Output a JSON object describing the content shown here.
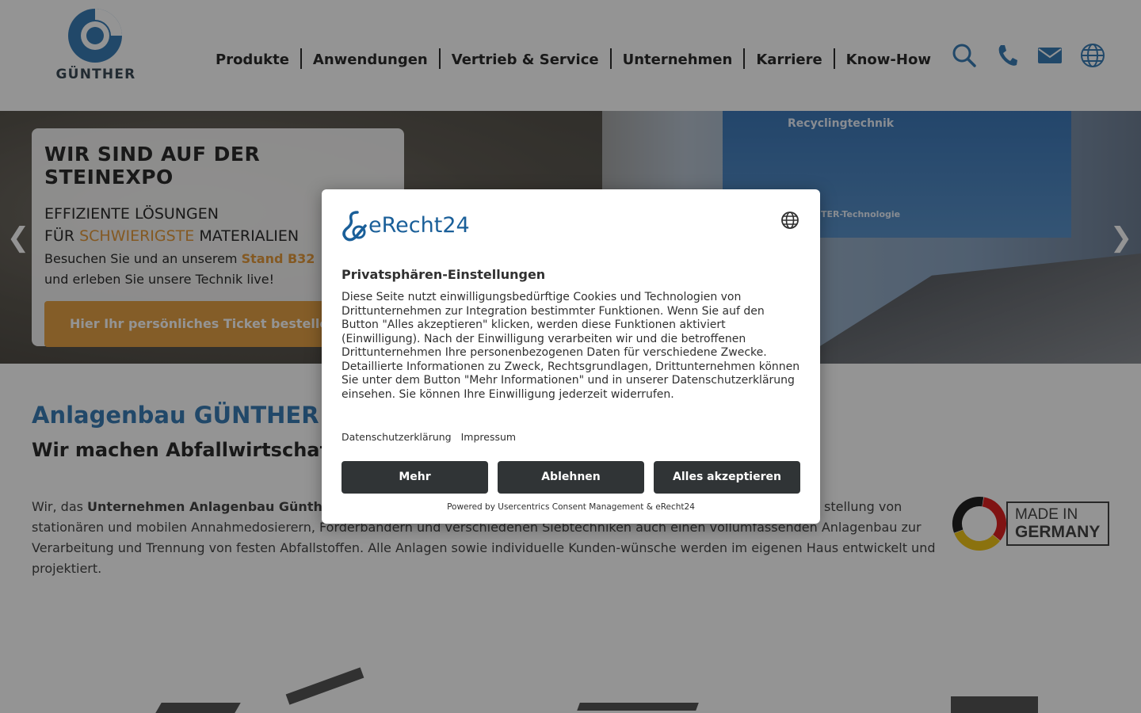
{
  "header": {
    "logo_text": "GÜNTHER",
    "nav": [
      "Produkte",
      "Anwendungen",
      "Vertrieb & Service",
      "Unternehmen",
      "Karriere",
      "Know-How"
    ],
    "icons": [
      "search-icon",
      "phone-icon",
      "mail-icon",
      "globe-icon"
    ],
    "brand_color": "#3a7db5"
  },
  "hero": {
    "banner_text": "Recyclingtechnik",
    "banner_sub": "TER-Technologie",
    "title": "WIR SIND AUF DER STEINEXPO",
    "sub_line1": "EFFIZIENTE LÖSUNGEN",
    "sub_line2_pre": "FÜR ",
    "sub_line2_accent": "SCHWIERIGSTE",
    "sub_line2_post": " MATERIALIEN",
    "text_pre": "Besuchen Sie und an unserem ",
    "text_accent": "Stand B32",
    "text_line2": "und erleben Sie unsere Technik live!",
    "cta": "Hier Ihr persönliches Ticket bestellen",
    "prev": "❮",
    "next": "❯",
    "accent_color": "#e39a3c"
  },
  "main": {
    "heading": "Anlagenbau GÜNTHER I",
    "subheading": "Wir machen Abfallwirtschaft",
    "body_pre": "Wir, das ",
    "body_bold": "Unternehmen Anlagenbau Günth",
    "body_visible_tail1": "stellung von",
    "body_line2": "stationären und mobilen Annahmedosierern, Förderbändern und verschiedenen Siebtechniken auch einen vollumfassenden Anlagenbau zur",
    "body_line3": "Verarbeitung und Trennung von festen Abfallstoffen. Alle Anlagen sowie individuelle Kunden-wünsche werden im eigenen Haus entwickelt und",
    "body_line4": "projektiert.",
    "badge_line1": "MADE IN",
    "badge_line2": "GERMANY"
  },
  "consent": {
    "brand": "eRecht24",
    "title": "Privatsphären-Einstellungen",
    "text": "Diese Seite nutzt einwilligungsbedürftige Cookies und Technologien von Drittunternehmen zur Integration bestimmter Funktionen. Wenn Sie auf den Button \"Alles akzeptieren\" klicken, werden diese Funktionen aktiviert (Einwilligung). Nach der Einwilligung verarbeiten wir und die betroffenen Drittunternehmen Ihre personenbezogenen Daten für verschiedene Zwecke. Detaillierte Informationen zu Zweck, Rechtsgrundlagen, Drittunternehmen können Sie unter dem Button \"Mehr Informationen\" und in unserer Datenschutzerklärung einsehen. Sie können Ihre Einwilligung jederzeit widerrufen.",
    "links": [
      "Datenschutzerklärung",
      "Impressum"
    ],
    "buttons": [
      "Mehr",
      "Ablehnen",
      "Alles akzeptieren"
    ],
    "footer": "Powered by Usercentrics Consent Management & eRecht24"
  }
}
